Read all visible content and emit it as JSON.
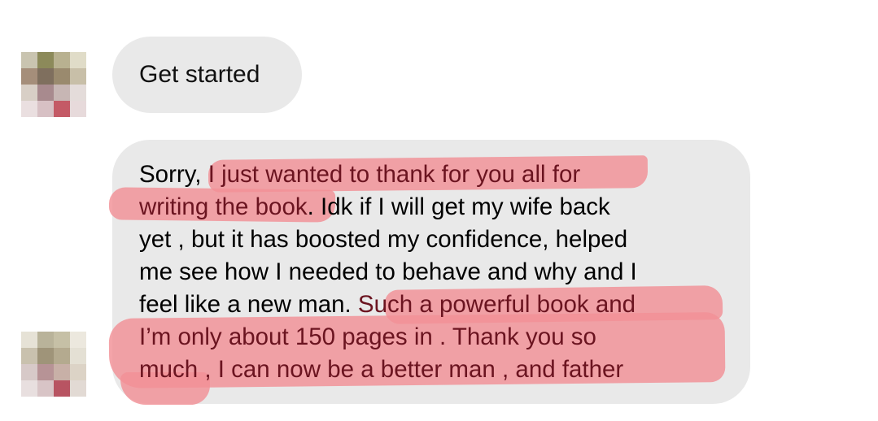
{
  "messages": [
    {
      "text": "Get started"
    },
    {
      "lines": [
        {
          "plain": "Sorry,",
          "highlight": "I just wanted to thank for you all for",
          "tail": ""
        },
        {
          "plain": "",
          "highlight": "writing the book",
          "tail": ". Idk if I will get my wife back"
        },
        {
          "plain": "yet , but it has boosted my confidence, helped",
          "highlight": "",
          "tail": ""
        },
        {
          "plain": "me see how I needed to behave and why and I",
          "highlight": "",
          "tail": ""
        },
        {
          "plain": "feel like a new man.",
          "highlight": "Such a powerful book and",
          "tail": ""
        },
        {
          "plain": "",
          "highlight": "I’m only about 150 pages in .  Thank you so",
          "tail": ""
        },
        {
          "plain": "",
          "highlight": "much , I can now be a better man , and father",
          "tail": ""
        }
      ]
    }
  ],
  "colors": {
    "bubble": "#e9e9e9",
    "highlight": "#f29096",
    "highlight_text": "#6b1420",
    "text": "#111111"
  }
}
